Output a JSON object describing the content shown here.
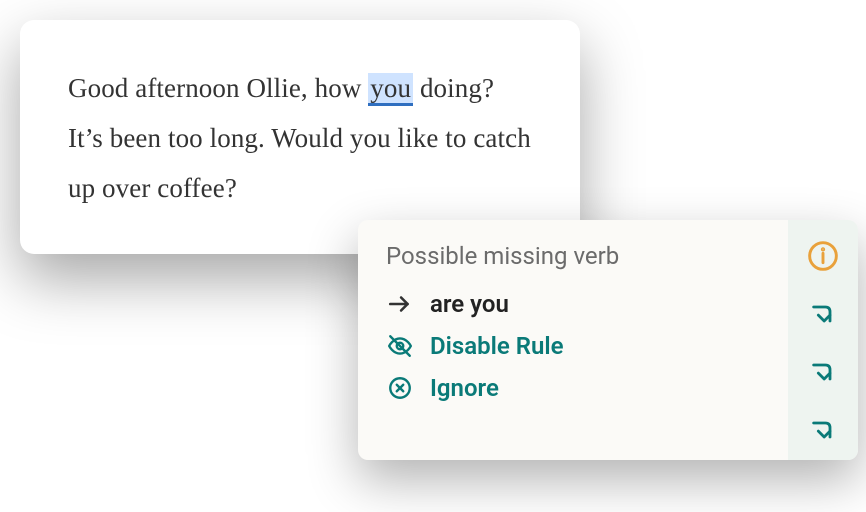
{
  "text": {
    "before": "Good afternoon Ollie, how ",
    "highlight": "you",
    "after": " doing? It’s been too long. Would you like to catch up over coffee?"
  },
  "popup": {
    "title": "Possible missing verb",
    "suggestion": "are you",
    "disable": "Disable Rule",
    "ignore": "Ignore"
  },
  "colors": {
    "teal": "#0a7a78",
    "info": "#e9a13b"
  }
}
